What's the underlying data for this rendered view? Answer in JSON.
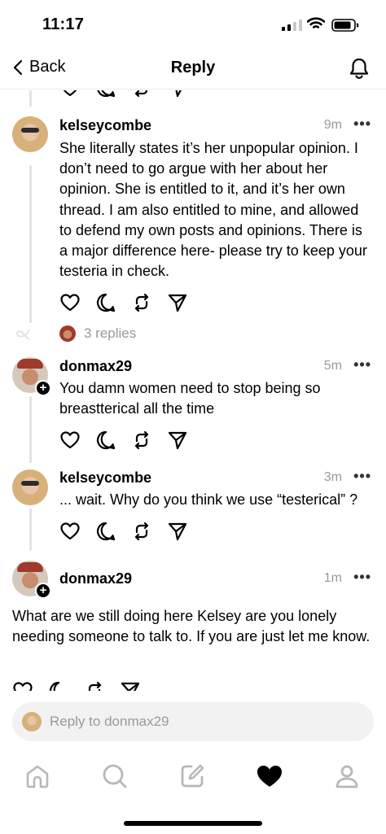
{
  "status_bar": {
    "time": "11:17"
  },
  "nav": {
    "back_label": "Back",
    "title": "Reply"
  },
  "posts": [
    {
      "username": "kelseycombe",
      "time": "9m",
      "text": "She literally states it’s her unpopular opinion. I don’t need to go argue with her about her opinion. She is entitled to it, and it’s her own thread. I am also entitled to mine, and allowed to defend my own posts and opinions. There is a major difference here- please try to keep your testeria in check.",
      "replies_label": "3 replies"
    },
    {
      "username": "donmax29",
      "time": "5m",
      "text": "You damn women need to stop being so breastterical all the time"
    },
    {
      "username": "kelseycombe",
      "time": "3m",
      "text": "... wait. Why do you think we use “testerical” ?"
    },
    {
      "username": "donmax29",
      "time": "1m",
      "text": "What are we still doing here Kelsey are you lonely needing someone to talk to. If you are just let me know."
    }
  ],
  "reply_bar": {
    "placeholder": "Reply to donmax29"
  },
  "more_glyph": "•••",
  "plus_glyph": "+",
  "icons": [
    "back-chevron-icon",
    "bell-icon",
    "heart-icon",
    "comment-icon",
    "repost-icon",
    "share-icon",
    "home-icon",
    "search-icon",
    "compose-icon",
    "activity-heart-icon",
    "profile-icon"
  ]
}
